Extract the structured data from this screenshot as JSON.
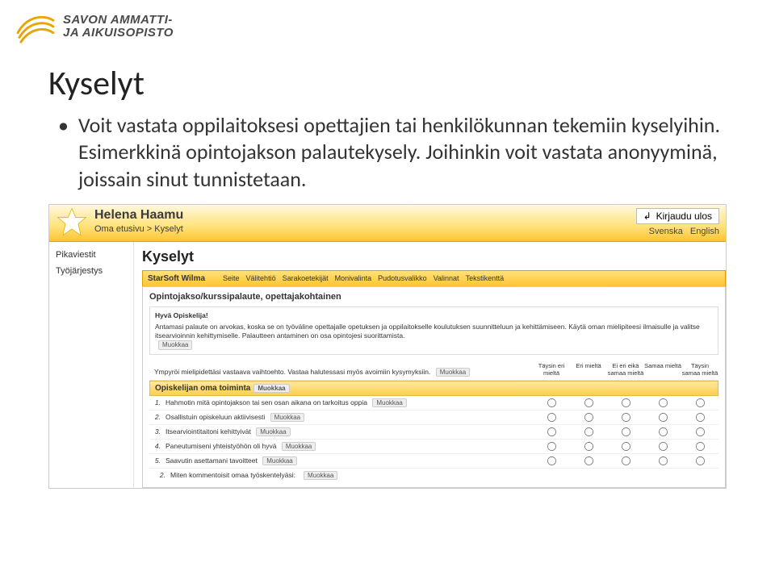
{
  "logo": {
    "line1": "SAVON AMMATTI-",
    "line2": "JA AIKUISOPISTO"
  },
  "page": {
    "title": "Kyselyt",
    "bullet": "Voit vastata oppilaitoksesi opettajien tai henkilökunnan tekemiin kyselyihin. Esimerkkinä opintojakson palautekysely. Joihinkin voit vastata anonyyminä, joissain sinut tunnistetaan."
  },
  "app": {
    "userName": "Helena Haamu",
    "breadcrumb_home": "Oma etusivu",
    "breadcrumb_sep": " > ",
    "breadcrumb_current": "Kyselyt",
    "logout": "Kirjaudu ulos",
    "lang_sv": "Svenska",
    "lang_en": "English",
    "sidebar": {
      "pikaviestit": "Pikaviestit",
      "tyojarjestys": "Työjärjestys"
    },
    "main_title": "Kyselyt",
    "tabs": {
      "brand": "StarSoft Wilma",
      "items": [
        "Seite",
        "Välitehtiö",
        "Sarakoetekijät",
        "Monivalinta",
        "Pudotusvalikko",
        "Valinnat",
        "Tekstikenttä"
      ]
    },
    "panel": {
      "title": "Opintojakso/kurssipalaute, opettajakohtainen",
      "greeting": "Hyvä Opiskelija!",
      "desc": "Antamasi palaute on arvokas, koska se on työväline opettajalle opetuksen ja oppilaitokselle koulutuksen suunnitteluun ja kehittämiseen. Käytä oman mielipiteesi ilmaisulle ja valitse itsearvioinnin kehittymiselle. Palautteen antaminen on osa opintojesi suorittamista.",
      "muokkaa": "Muokkaa",
      "instr": "Ympyröi mielipidettäsi vastaava vaihtoehto. Vastaa halutessasi myös avoimiin kysymyksiin.",
      "scale": [
        "Täysin eri mieltä",
        "Eri mieltä",
        "Ei eri eikä samaa mieltä",
        "Samaa mieltä",
        "Täysin samaa mieltä"
      ],
      "section": "Opiskelijan oma toiminta",
      "questions": [
        {
          "n": "1.",
          "t": "Hahmotin mitä opintojakson tai sen osan aikana on tarkoitus oppia"
        },
        {
          "n": "2.",
          "t": "Osallistuin opiskeluun aktiivisesti"
        },
        {
          "n": "3.",
          "t": "Itsearviointitaitoni kehittyivät"
        },
        {
          "n": "4.",
          "t": "Paneutumiseni yhteistyöhön oli hyvä"
        },
        {
          "n": "5.",
          "t": "Saavutin asettamani tavoitteet"
        }
      ],
      "free_prompt_num": "2.",
      "free_prompt": "Miten kommentoisit omaa työskentelyäsi:"
    }
  }
}
